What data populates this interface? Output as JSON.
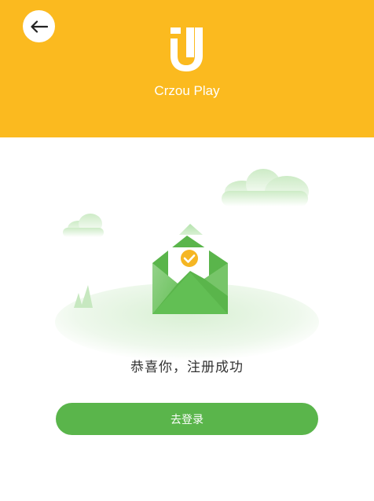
{
  "header": {
    "app_name": "Crzou Play",
    "background_color": "#FBBA1F",
    "back_icon": "arrow-left-icon",
    "logo_icon": "crzou-logo-icon"
  },
  "main": {
    "illustration_icon": "envelope-success-icon",
    "success_message": "恭喜你，注册成功",
    "login_button_label": "去登录",
    "accent_color": "#5AB54B"
  }
}
